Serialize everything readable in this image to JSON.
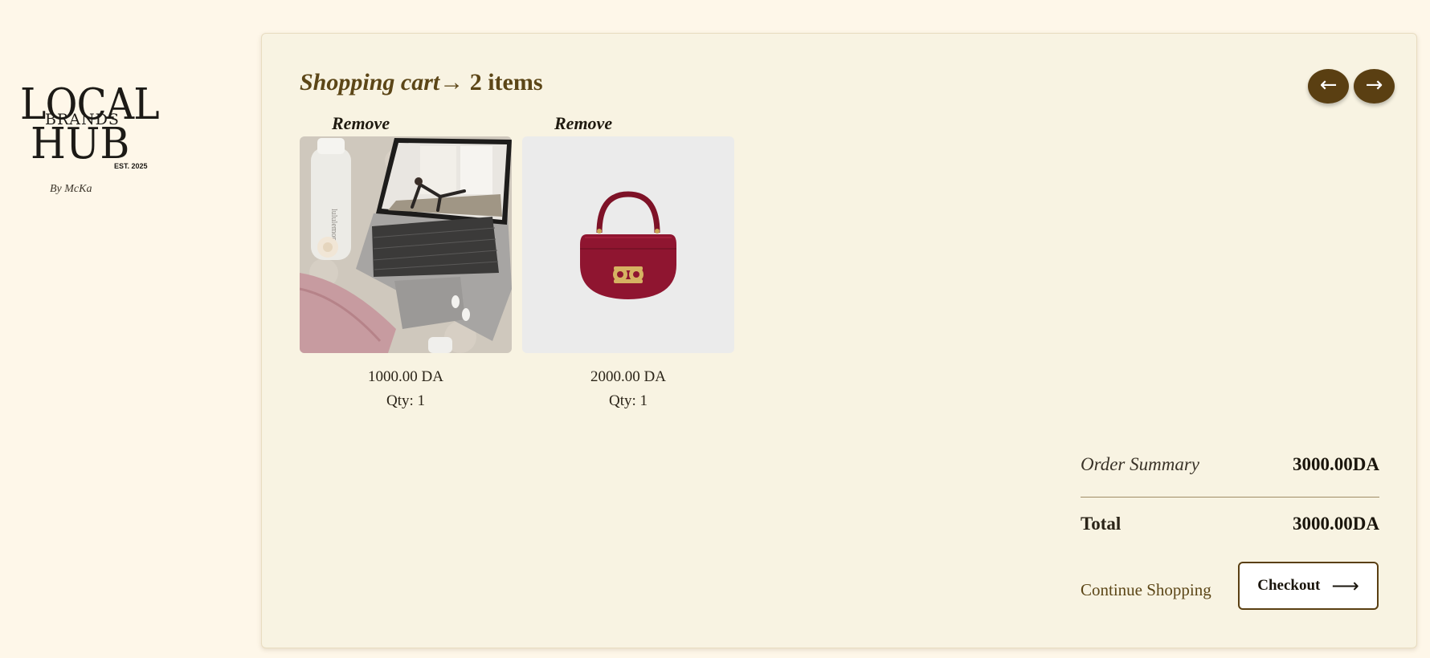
{
  "brand": {
    "line1": "LOCAL",
    "line2": "BRANDS",
    "line3": "HUB",
    "est": "EST. 2025",
    "by": "By McKa"
  },
  "cart": {
    "title_italic": "Shopping cart",
    "arrow": "→",
    "title_count": " 2 items"
  },
  "nav": {
    "prev_icon": "←",
    "next_icon": "→"
  },
  "items": [
    {
      "remove_label": "Remove",
      "price": "1000.00 DA",
      "qty": "Qty: 1",
      "image_icon": "laptop-yoga-photo"
    },
    {
      "remove_label": "Remove",
      "price": "2000.00 DA",
      "qty": "Qty: 1",
      "image_icon": "red-handbag-photo"
    }
  ],
  "summary": {
    "order_summary_label": "Order Summary",
    "order_summary_value": "3000.00DA",
    "total_label": "Total",
    "total_value": "3000.00DA",
    "continue_label": "Continue Shopping",
    "checkout_label": "Checkout",
    "checkout_arrow": "⟶"
  },
  "colors": {
    "page_bg": "#fef7e9",
    "panel_bg": "#f8f3e2",
    "accent_brown": "#5a3f12",
    "title_brown": "#5c4617"
  }
}
